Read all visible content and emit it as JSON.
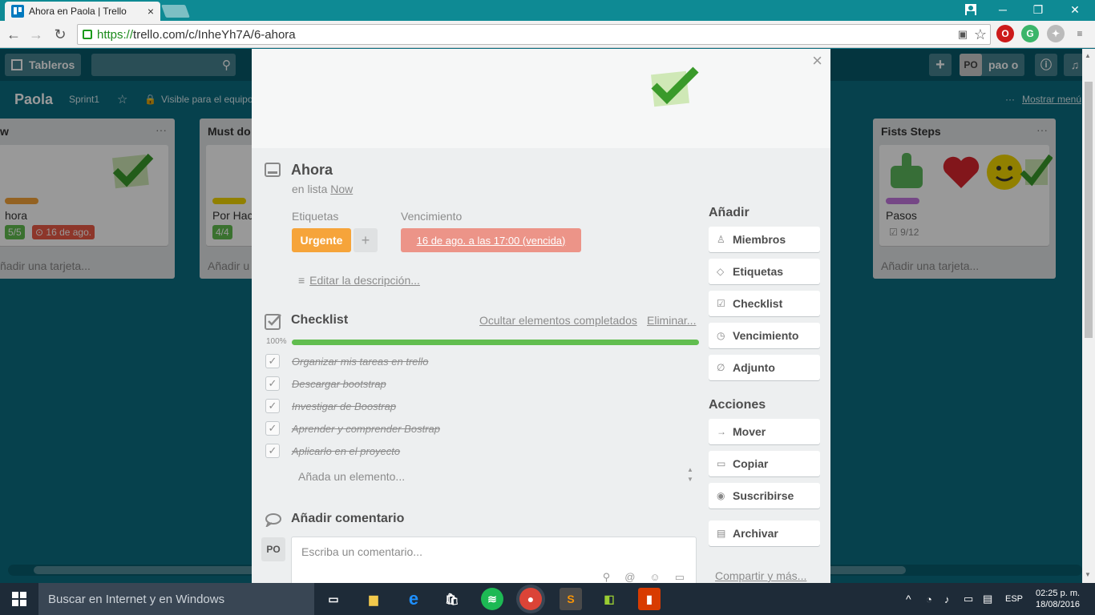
{
  "browser": {
    "tab_title": "Ahora en Paola | Trello",
    "tab_close": "×",
    "url_scheme": "https://",
    "url_rest": "trello.com/c/InheYh7A/6-ahora",
    "win_min": "─",
    "win_max": "❐",
    "win_close": "✕"
  },
  "header": {
    "boards_label": "Tableros",
    "user_initials": "PO",
    "user_name": "pao o"
  },
  "board": {
    "name": "Paola",
    "sprint": "Sprint1",
    "visibility": "Visible para el equipo",
    "menu": "Mostrar menú",
    "dots": "···"
  },
  "lists": [
    {
      "title": "w",
      "card_name": "hora",
      "badge_checklist": "5/5",
      "badge_due": "16 de ago.",
      "add_card": "ñadir una tarjeta..."
    },
    {
      "title": "Must do",
      "card_name": "Por Hac",
      "badge_checklist": "4/4",
      "add_card": "Añadir u"
    },
    {
      "title": "Fists Steps",
      "card_name": "Pasos",
      "badge_checklist": "9/12",
      "add_card": "Añadir una tarjeta..."
    }
  ],
  "card": {
    "title": "Ahora",
    "in_list_prefix": "en lista",
    "list_name": "Now",
    "labels_heading": "Etiquetas",
    "label": "Urgente",
    "label_add": "+",
    "due_heading": "Vencimiento",
    "due": "16 de ago. a las 17:00 (vencida)",
    "edit_description": "Editar la descripción...",
    "close": "×"
  },
  "checklist": {
    "title": "Checklist",
    "hide_completed": "Ocultar elementos completados",
    "delete": "Eliminar...",
    "percent_label": "100%",
    "progress": 1.0,
    "items": [
      {
        "text": "Organizar mis tareas en trello",
        "done": true
      },
      {
        "text": "Descargar bootstrap",
        "done": true
      },
      {
        "text": "Investigar de Boostrap",
        "done": true
      },
      {
        "text": "Aprender y comprender Bostrap",
        "done": true
      },
      {
        "text": "Aplicarlo en el proyecto",
        "done": true
      }
    ],
    "add_item_placeholder": "Añada un elemento..."
  },
  "comment": {
    "title": "Añadir comentario",
    "avatar": "PO",
    "placeholder": "Escriba un comentario..."
  },
  "sidebar": {
    "add_heading": "Añadir",
    "add_buttons": [
      "Miembros",
      "Etiquetas",
      "Checklist",
      "Vencimiento",
      "Adjunto"
    ],
    "actions_heading": "Acciones",
    "action_buttons": [
      "Mover",
      "Copiar",
      "Suscribirse",
      "Archivar"
    ],
    "share": "Compartir y más..."
  },
  "taskbar": {
    "search": "Buscar en Internet y en Windows",
    "lang": "ESP",
    "time": "02:25 p. m.",
    "date": "18/08/2016"
  },
  "colors": {
    "trello_bg": "#0a6d80",
    "label_orange": "#f6a43a",
    "due_overdue": "#ec9488",
    "progress_green": "#61bd4f",
    "badge_green": "#61bd4f",
    "badge_red": "#eb5a46"
  }
}
